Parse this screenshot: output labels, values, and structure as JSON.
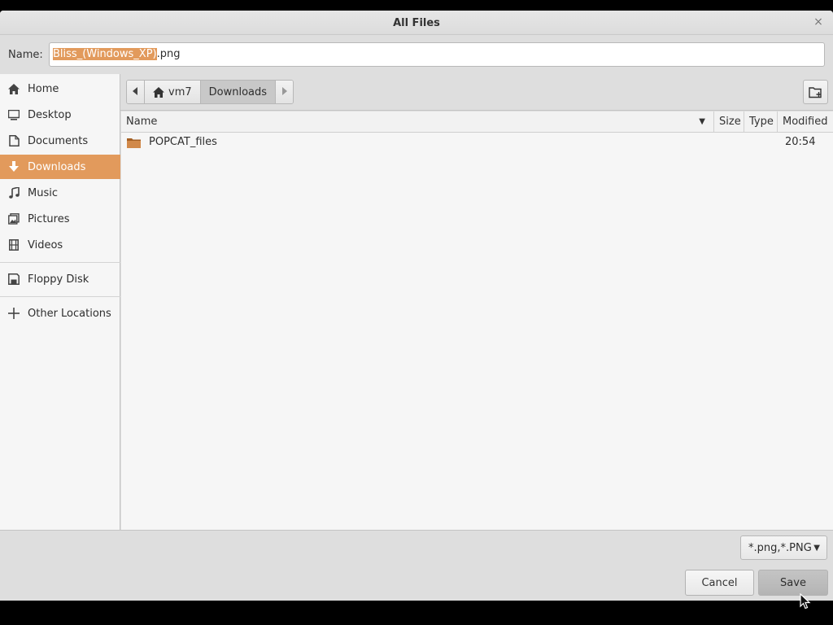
{
  "window": {
    "title": "All Files",
    "close_glyph": "×"
  },
  "name_field": {
    "label": "Name:",
    "selected_part": "Bliss_(Windows_XP)",
    "rest_part": ".png"
  },
  "sidebar": {
    "items": [
      {
        "label": "Home",
        "icon": "home-icon"
      },
      {
        "label": "Desktop",
        "icon": "desktop-icon"
      },
      {
        "label": "Documents",
        "icon": "documents-icon"
      },
      {
        "label": "Downloads",
        "icon": "downloads-icon",
        "active": true
      },
      {
        "label": "Music",
        "icon": "music-icon"
      },
      {
        "label": "Pictures",
        "icon": "pictures-icon"
      },
      {
        "label": "Videos",
        "icon": "videos-icon"
      },
      {
        "label": "Floppy Disk",
        "icon": "floppy-icon"
      },
      {
        "label": "Other Locations",
        "icon": "plus-icon"
      }
    ]
  },
  "pathbar": {
    "segments": [
      {
        "label": "vm7",
        "icon": "home-icon"
      },
      {
        "label": "Downloads",
        "current": true
      }
    ]
  },
  "columns": {
    "name": "Name",
    "size": "Size",
    "type": "Type",
    "modified": "Modified"
  },
  "files": [
    {
      "name": "POPCAT_files",
      "kind": "folder",
      "modified": "20:54"
    }
  ],
  "filter": {
    "value": "*.png,*.PNG"
  },
  "buttons": {
    "cancel": "Cancel",
    "save": "Save"
  },
  "colors": {
    "accent": "#e29a5c",
    "folder": "#c97a3a"
  }
}
